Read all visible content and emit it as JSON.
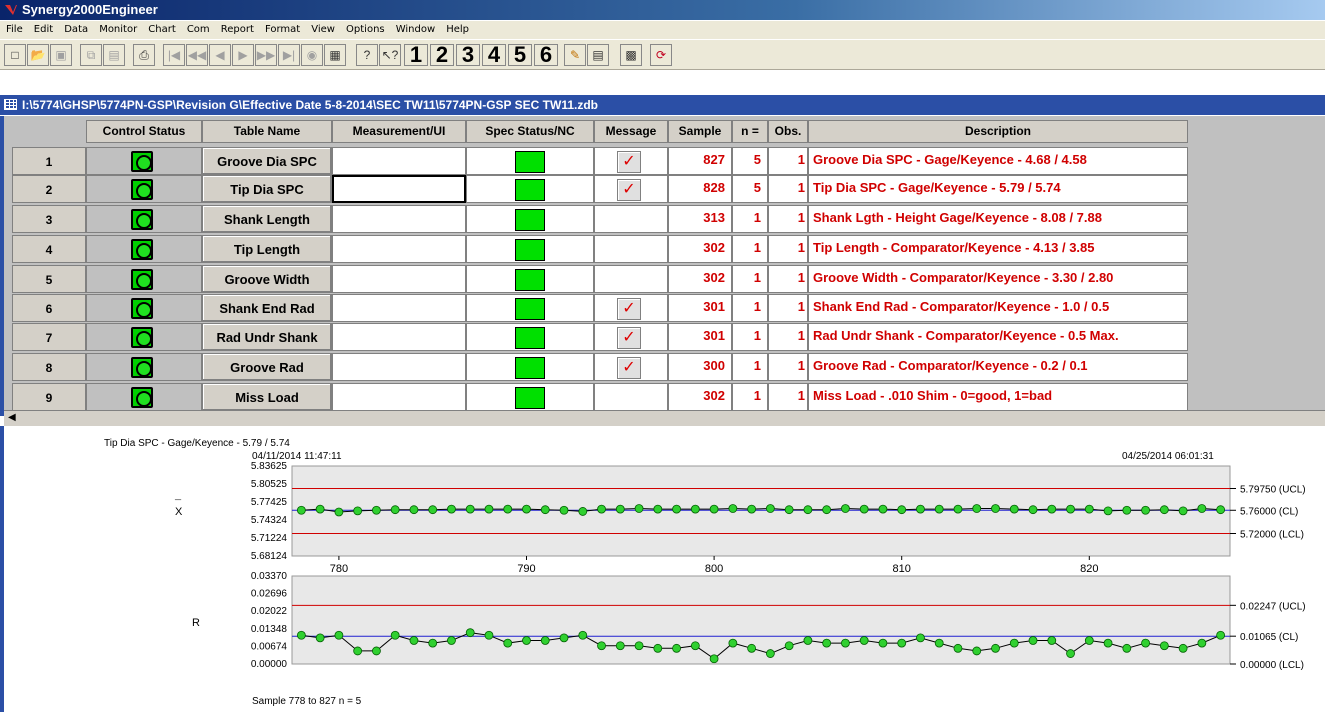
{
  "app": {
    "title": "Synergy2000Engineer",
    "menu": [
      "File",
      "Edit",
      "Data",
      "Monitor",
      "Chart",
      "Com",
      "Report",
      "Format",
      "View",
      "Options",
      "Window",
      "Help"
    ],
    "toolbar_numbers": [
      "1",
      "2",
      "3",
      "4",
      "5",
      "6"
    ]
  },
  "document": {
    "path": "I:\\5774\\GHSP\\5774PN-GSP\\Revision G\\Effective Date 5-8-2014\\SEC TW11\\5774PN-GSP SEC TW11.zdb"
  },
  "table": {
    "headers": [
      "Control Status",
      "Table Name",
      "Measurement/UI",
      "Spec Status/NC",
      "Message",
      "Sample",
      "n =",
      "Obs.",
      "Description"
    ],
    "rows": [
      {
        "num": "1",
        "name": "Groove Dia SPC",
        "message": true,
        "sample": "827",
        "n": "5",
        "obs": "1",
        "description": "Groove Dia SPC - Gage/Keyence - 4.68 / 4.58"
      },
      {
        "num": "2",
        "name": "Tip Dia SPC",
        "message": true,
        "sample": "828",
        "n": "5",
        "obs": "1",
        "description": "Tip Dia SPC - Gage/Keyence - 5.79 / 5.74"
      },
      {
        "num": "3",
        "name": "Shank Length",
        "message": false,
        "sample": "313",
        "n": "1",
        "obs": "1",
        "description": "Shank Lgth - Height Gage/Keyence - 8.08 / 7.88"
      },
      {
        "num": "4",
        "name": "Tip Length",
        "message": false,
        "sample": "302",
        "n": "1",
        "obs": "1",
        "description": "Tip Length - Comparator/Keyence - 4.13 / 3.85"
      },
      {
        "num": "5",
        "name": "Groove Width",
        "message": false,
        "sample": "302",
        "n": "1",
        "obs": "1",
        "description": "Groove Width - Comparator/Keyence - 3.30 / 2.80"
      },
      {
        "num": "6",
        "name": "Shank End Rad",
        "message": true,
        "sample": "301",
        "n": "1",
        "obs": "1",
        "description": "Shank End Rad - Comparator/Keyence - 1.0 / 0.5"
      },
      {
        "num": "7",
        "name": "Rad Undr Shank",
        "message": true,
        "sample": "301",
        "n": "1",
        "obs": "1",
        "description": "Rad Undr Shank - Comparator/Keyence - 0.5 Max."
      },
      {
        "num": "8",
        "name": "Groove Rad",
        "message": true,
        "sample": "300",
        "n": "1",
        "obs": "1",
        "description": "Groove Rad - Comparator/Keyence - 0.2 / 0.1"
      },
      {
        "num": "9",
        "name": "Miss Load",
        "message": false,
        "sample": "302",
        "n": "1",
        "obs": "1",
        "description": "Miss Load - .010 Shim - 0=good, 1=bad"
      }
    ]
  },
  "chart": {
    "title": "Tip Dia SPC - Gage/Keyence - 5.79 / 5.74",
    "start_time": "04/11/2014  11:47:11",
    "end_time": "04/25/2014  06:01:31",
    "footer": "Sample  778  to  827   n = 5",
    "xbar_label": "X",
    "r_label": "R",
    "xbar_ticks": [
      "5.83625",
      "5.80525",
      "5.77425",
      "5.74324",
      "5.71224",
      "5.68124"
    ],
    "r_ticks": [
      "0.03370",
      "0.02696",
      "0.02022",
      "0.01348",
      "0.00674",
      "0.00000"
    ],
    "x_ticks": [
      "780",
      "790",
      "800",
      "810",
      "820"
    ],
    "xbar_limits": [
      "5.79750 (UCL)",
      "5.76000 (CL)",
      "5.72000 (LCL)"
    ],
    "r_limits": [
      "0.02247 (UCL)",
      "0.01065 (CL)",
      "0.00000 (LCL)"
    ]
  },
  "chart_data": [
    {
      "type": "line",
      "name": "X-bar",
      "x": [
        778,
        779,
        780,
        781,
        782,
        783,
        784,
        785,
        786,
        787,
        788,
        789,
        790,
        791,
        792,
        793,
        794,
        795,
        796,
        797,
        798,
        799,
        800,
        801,
        802,
        803,
        804,
        805,
        806,
        807,
        808,
        809,
        810,
        811,
        812,
        813,
        814,
        815,
        816,
        817,
        818,
        819,
        820,
        821,
        822,
        823,
        824,
        825,
        826,
        827
      ],
      "values": [
        5.76,
        5.762,
        5.757,
        5.759,
        5.76,
        5.761,
        5.761,
        5.761,
        5.762,
        5.762,
        5.762,
        5.762,
        5.762,
        5.761,
        5.76,
        5.758,
        5.762,
        5.762,
        5.763,
        5.762,
        5.762,
        5.762,
        5.762,
        5.763,
        5.762,
        5.763,
        5.761,
        5.761,
        5.761,
        5.763,
        5.762,
        5.762,
        5.761,
        5.762,
        5.762,
        5.762,
        5.763,
        5.763,
        5.762,
        5.761,
        5.762,
        5.762,
        5.762,
        5.759,
        5.76,
        5.76,
        5.761,
        5.759,
        5.763,
        5.761
      ],
      "ucl": 5.7975,
      "cl": 5.76,
      "lcl": 5.72,
      "ylim": [
        5.68124,
        5.83625
      ]
    },
    {
      "type": "line",
      "name": "R",
      "x": [
        778,
        779,
        780,
        781,
        782,
        783,
        784,
        785,
        786,
        787,
        788,
        789,
        790,
        791,
        792,
        793,
        794,
        795,
        796,
        797,
        798,
        799,
        800,
        801,
        802,
        803,
        804,
        805,
        806,
        807,
        808,
        809,
        810,
        811,
        812,
        813,
        814,
        815,
        816,
        817,
        818,
        819,
        820,
        821,
        822,
        823,
        824,
        825,
        826,
        827
      ],
      "values": [
        0.011,
        0.01,
        0.011,
        0.005,
        0.005,
        0.011,
        0.009,
        0.008,
        0.009,
        0.012,
        0.011,
        0.008,
        0.009,
        0.009,
        0.01,
        0.011,
        0.007,
        0.007,
        0.007,
        0.006,
        0.006,
        0.007,
        0.002,
        0.008,
        0.006,
        0.004,
        0.007,
        0.009,
        0.008,
        0.008,
        0.009,
        0.008,
        0.008,
        0.01,
        0.008,
        0.006,
        0.005,
        0.006,
        0.008,
        0.009,
        0.009,
        0.004,
        0.009,
        0.008,
        0.006,
        0.008,
        0.007,
        0.006,
        0.008,
        0.011
      ],
      "ucl": 0.02247,
      "cl": 0.01065,
      "lcl": 0.0,
      "ylim": [
        0.0,
        0.0337
      ]
    }
  ]
}
